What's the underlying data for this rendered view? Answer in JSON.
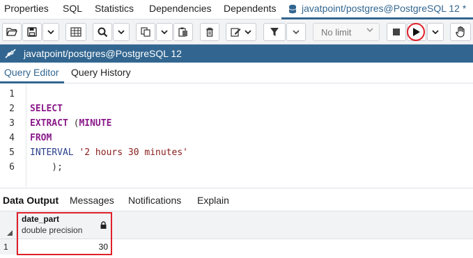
{
  "top_tabs": {
    "properties": "Properties",
    "sql": "SQL",
    "statistics": "Statistics",
    "dependencies": "Dependencies",
    "dependents": "Dependents",
    "query_tab": "javatpoint/postgres@PostgreSQL 12 *"
  },
  "toolbar": {
    "limit_select": "No limit",
    "icons": [
      "open-folder-icon",
      "save-icon",
      "chevron-down-icon",
      "grid-icon",
      "search-icon",
      "chevron-down-icon",
      "copy-icon",
      "chevron-down-icon",
      "paste-icon",
      "delete-icon",
      "edit-icon",
      "chevron-down-icon",
      "filter-icon",
      "chevron-down-icon",
      "chevron-down-icon",
      "stop-icon",
      "play-icon",
      "chevron-down-icon",
      "hand-icon"
    ]
  },
  "connection": {
    "label": "javatpoint/postgres@PostgreSQL 12"
  },
  "editor_tabs": {
    "query_editor": "Query Editor",
    "query_history": "Query History"
  },
  "editor": {
    "line_numbers": [
      "1",
      "2",
      "3",
      "4",
      "5",
      "6"
    ],
    "lines": [
      [],
      [
        {
          "t": "SELECT",
          "c": "kw"
        }
      ],
      [
        {
          "t": "EXTRACT",
          "c": "kw"
        },
        {
          "t": " (",
          "c": "pn"
        },
        {
          "t": "MINUTE",
          "c": "kw"
        }
      ],
      [
        {
          "t": "FROM",
          "c": "kw"
        }
      ],
      [
        {
          "t": "INTERVAL ",
          "c": "ty"
        },
        {
          "t": "'2 hours 30 minutes'",
          "c": "str"
        }
      ],
      [
        {
          "t": "    );",
          "c": "pn"
        }
      ]
    ]
  },
  "results_tabs": {
    "data_output": "Data Output",
    "messages": "Messages",
    "notifications": "Notifications",
    "explain": "Explain"
  },
  "grid": {
    "column_name": "date_part",
    "column_type": "double precision",
    "rows": [
      {
        "row_number": "1",
        "value": "30"
      }
    ]
  },
  "colors": {
    "accent": "#326690",
    "highlight": "#e0202a"
  }
}
